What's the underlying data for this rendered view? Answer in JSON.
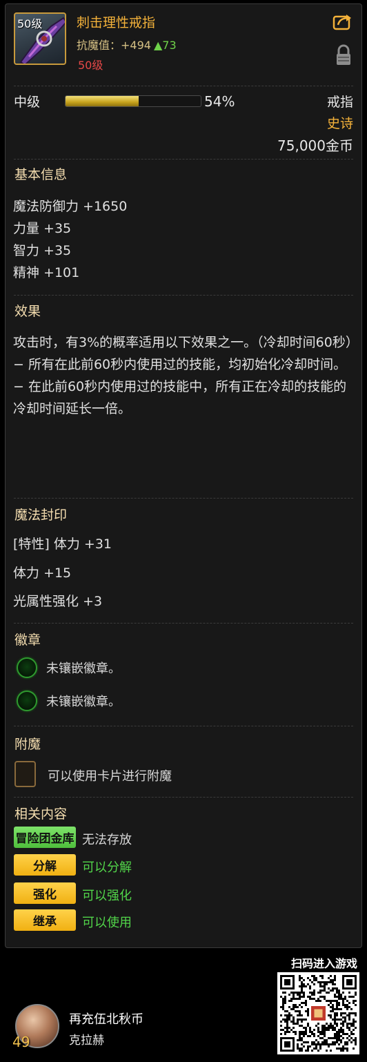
{
  "item": {
    "level_badge": "50级",
    "name": "刺击理性戒指",
    "resist_label": "抗魔值：",
    "resist_value": "+494",
    "resist_delta": "▲73",
    "required_level": "50级",
    "grade": "中级",
    "grade_percent_text": "54%",
    "grade_fraction": 0.54,
    "type": "戒指",
    "rarity": "史诗",
    "price": "75,000金币"
  },
  "basic_info": {
    "title": "基本信息",
    "stats": [
      "魔法防御力 +1650",
      "力量 +35",
      "智力 +35",
      "精神 +101"
    ]
  },
  "effect": {
    "title": "效果",
    "lines": [
      "攻击时，有3%的概率适用以下效果之一。（冷却时间60秒）",
      "− 所有在此前60秒内使用过的技能，均初始化冷却时间。",
      "− 在此前60秒内使用过的技能中，所有正在冷却的技能的冷却时间延长一倍。"
    ]
  },
  "seal": {
    "title": "魔法封印",
    "stats": [
      "[特性] 体力 +31",
      "体力 +15",
      "光属性强化 +3"
    ]
  },
  "emblem": {
    "title": "徽章",
    "slots": [
      "未镶嵌徽章。",
      "未镶嵌徽章。"
    ]
  },
  "enchant": {
    "title": "附魔",
    "text": "可以使用卡片进行附魔"
  },
  "related": {
    "title": "相关内容",
    "rows": [
      {
        "tag": "冒险团金库",
        "value": "无法存放",
        "style": "green",
        "value_color": "#d8d8d8"
      },
      {
        "tag": "分解",
        "value": "可以分解",
        "style": "gold",
        "value_color": "#52d64a"
      },
      {
        "tag": "强化",
        "value": "可以强化",
        "style": "gold",
        "value_color": "#52d64a"
      },
      {
        "tag": "继承",
        "value": "可以使用",
        "style": "gold",
        "value_color": "#52d64a"
      }
    ]
  },
  "footer": {
    "qr_caption": "扫码进入游戏",
    "avatar_level": "49",
    "player_name": "再充伍北秋币",
    "server_name": "克拉赫"
  },
  "colors": {
    "epic": "#f4b23a",
    "positive": "#52d64a",
    "warning": "#e64848",
    "section_title": "#f5deb0"
  }
}
